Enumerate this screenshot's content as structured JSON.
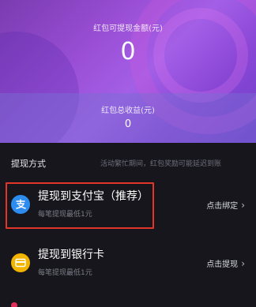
{
  "hero": {
    "available_label": "红包可提现金额(元)",
    "available_value": "0",
    "total_label": "红包总收益(元)",
    "total_value": "0"
  },
  "section": {
    "title": "提现方式",
    "note": "活动繁忙期间，红包奖励可能延迟到账"
  },
  "options": [
    {
      "icon": "alipay-icon",
      "title": "提现到支付宝（推荐）",
      "subtitle": "每笔提现最低1元",
      "action": "点击绑定",
      "highlighted": true
    },
    {
      "icon": "bank-card-icon",
      "title": "提现到银行卡",
      "subtitle": "每笔提现最低1元",
      "action": "点击提现",
      "highlighted": false
    }
  ],
  "colors": {
    "accent_purple": "#9a4fd6",
    "alipay_blue": "#2d8cf0",
    "bank_yellow": "#f3b400",
    "highlight_red": "#e2362b",
    "background": "#16161c"
  }
}
